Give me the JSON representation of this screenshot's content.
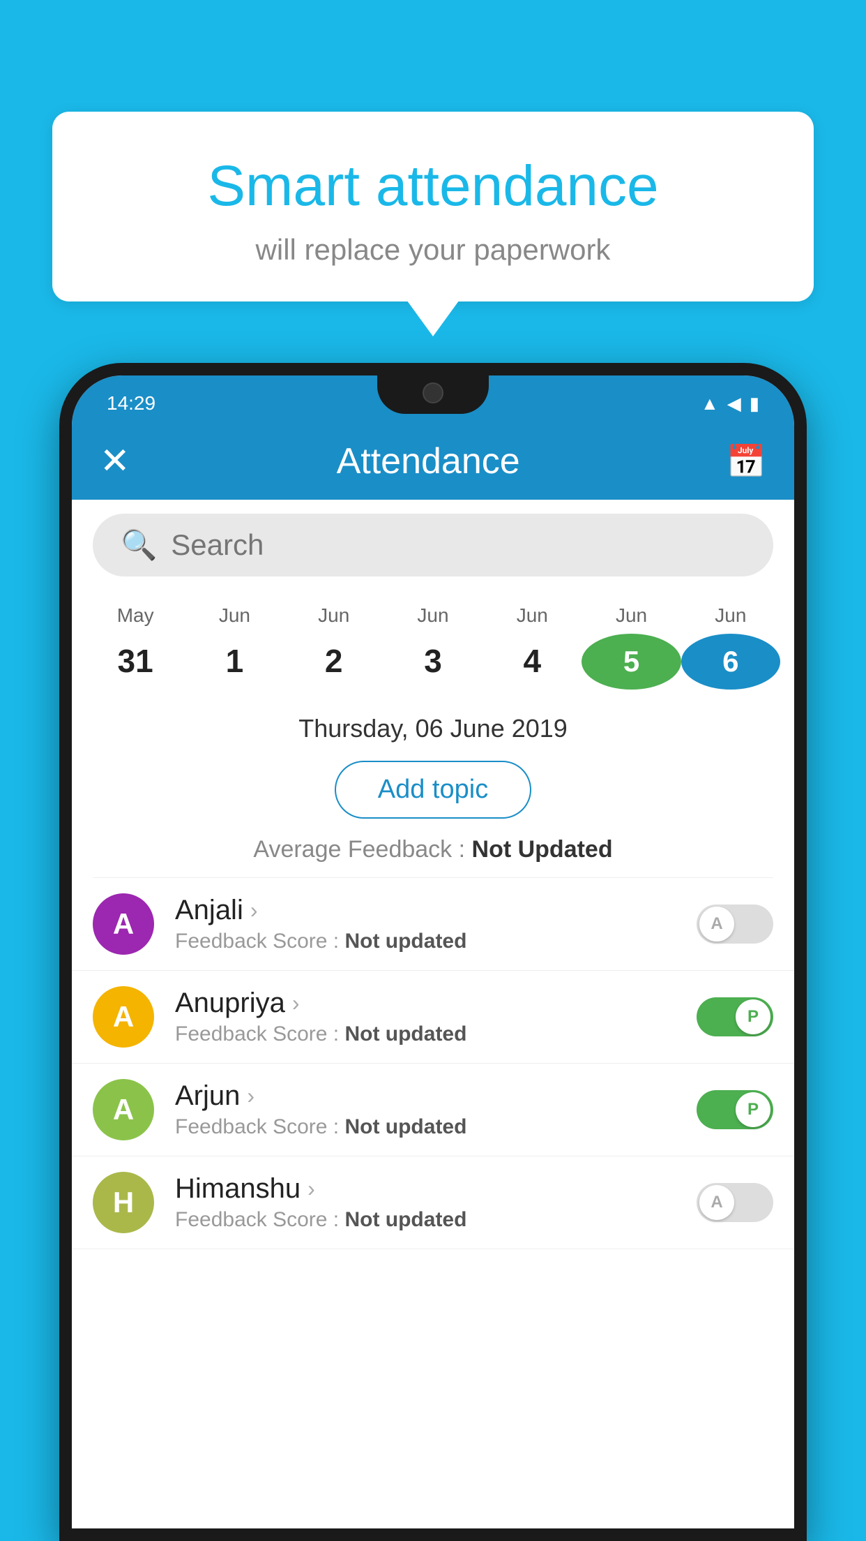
{
  "background": {
    "color": "#1ab8e8"
  },
  "bubble": {
    "title": "Smart attendance",
    "subtitle": "will replace your paperwork"
  },
  "phone": {
    "statusBar": {
      "time": "14:29"
    },
    "appBar": {
      "title": "Attendance",
      "closeLabel": "✕",
      "calendarIcon": "🗓"
    },
    "search": {
      "placeholder": "Search"
    },
    "calendar": {
      "months": [
        "May",
        "Jun",
        "Jun",
        "Jun",
        "Jun",
        "Jun",
        "Jun"
      ],
      "dates": [
        "31",
        "1",
        "2",
        "3",
        "4",
        "5",
        "6"
      ],
      "todayIndex": 5,
      "selectedIndex": 6
    },
    "dateInfo": "Thursday, 06 June 2019",
    "addTopicLabel": "Add topic",
    "avgFeedback": {
      "label": "Average Feedback : ",
      "value": "Not Updated"
    },
    "students": [
      {
        "name": "Anjali",
        "avatarLetter": "A",
        "avatarColor": "#9c27b0",
        "feedback": "Not updated",
        "status": "absent"
      },
      {
        "name": "Anupriya",
        "avatarLetter": "A",
        "avatarColor": "#f4b400",
        "feedback": "Not updated",
        "status": "present"
      },
      {
        "name": "Arjun",
        "avatarLetter": "A",
        "avatarColor": "#8bc34a",
        "feedback": "Not updated",
        "status": "present"
      },
      {
        "name": "Himanshu",
        "avatarLetter": "H",
        "avatarColor": "#aab84a",
        "feedback": "Not updated",
        "status": "absent"
      }
    ]
  }
}
